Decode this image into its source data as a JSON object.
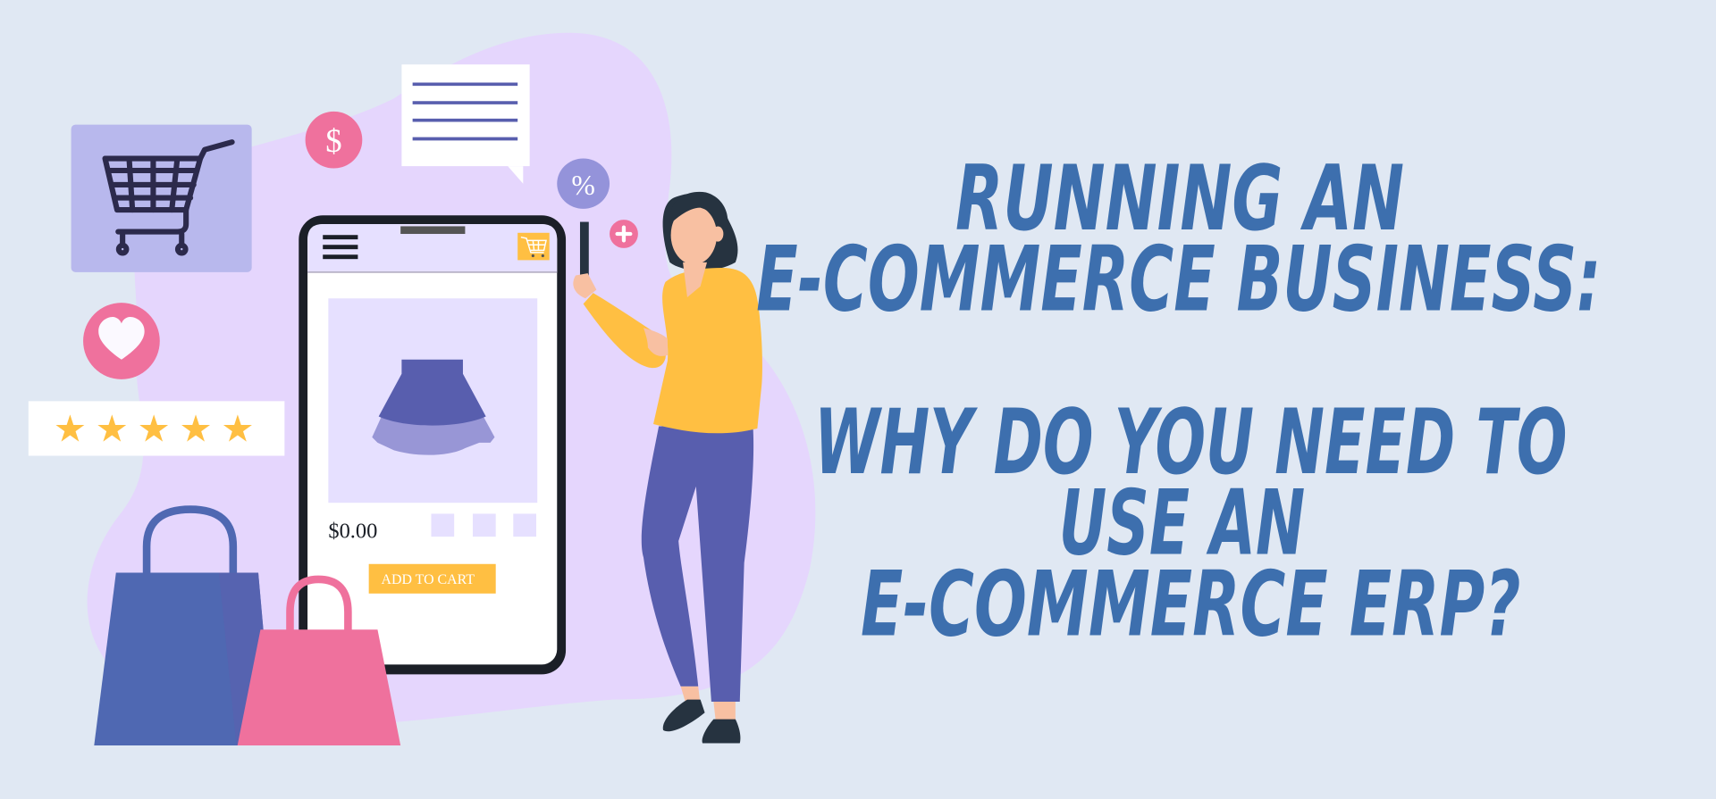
{
  "colors": {
    "background": "#e0e8f3",
    "blob": "#e5d6fd",
    "headline": "#3d6fae",
    "pink": "#ef719d",
    "lavender_box": "#b8b8ed",
    "indigo": "#585eae",
    "yellow": "#ffbf42",
    "dark": "#1b1f27",
    "percent_bubble": "#9493da"
  },
  "headline": {
    "lines": [
      "RUNNING AN",
      "E-COMMERCE BUSINESS:",
      "",
      "WHY DO YOU NEED TO",
      "USE AN",
      "E-COMMERCE ERP?"
    ]
  },
  "badges": {
    "dollar": "$",
    "percent": "%",
    "plus": "+"
  },
  "icons": {
    "cart_card": "shopping-cart-icon",
    "heart": "heart-icon",
    "menu": "hamburger-menu-icon",
    "phone_cart": "cart-icon",
    "document": "document-lines-icon"
  },
  "rating": {
    "stars": 5,
    "max": 5,
    "glyph": "★"
  },
  "phone": {
    "price": "$0.00",
    "add_to_cart_label": "ADD TO CART",
    "variant_swatches": 3
  }
}
